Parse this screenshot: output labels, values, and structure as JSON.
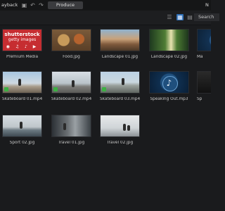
{
  "topbar": {
    "left_text": "ayback",
    "produce_label": "Produce",
    "right_text": "N"
  },
  "viewbar": {
    "search_text": "Search"
  },
  "media": [
    {
      "name": "Premium Media"
    },
    {
      "name": "Food.jpg"
    },
    {
      "name": "Landscape 01.jpg"
    },
    {
      "name": "Landscape 02.jpg"
    },
    {
      "name": "Ma"
    },
    {
      "name": "Skateboard 01.mp4"
    },
    {
      "name": "Skateboard 02.mp4"
    },
    {
      "name": "Skateboard 03.mp4"
    },
    {
      "name": "Speaking Out.mp3"
    },
    {
      "name": "Sp"
    },
    {
      "name": "Sport 02.jpg"
    },
    {
      "name": "Travel 01.jpg"
    },
    {
      "name": "Travel 02.jpg"
    }
  ],
  "premium": {
    "line1": "shutterstock",
    "line2": "getty images",
    "icons": "◉ ♫ ♪ ▶"
  },
  "icons": {
    "speaking_note": "♪"
  }
}
